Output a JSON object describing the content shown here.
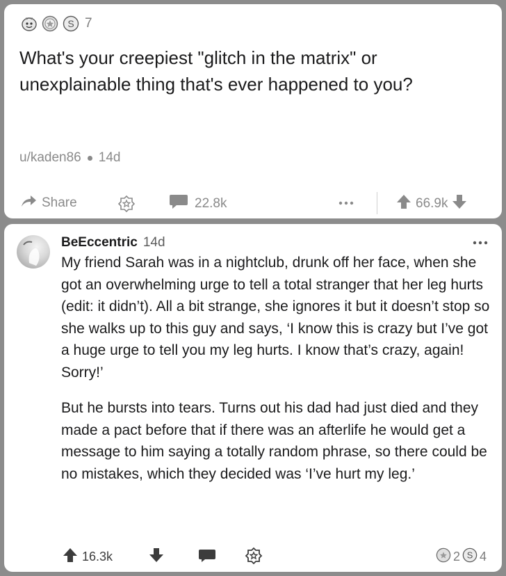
{
  "post": {
    "award_count": "7",
    "title": "What's your creepiest \"glitch in the matrix\" or unexplainable thing that's ever happened to you?",
    "author": "u/kaden86",
    "age": "14d",
    "actions": {
      "share_label": "Share",
      "comments_count": "22.8k",
      "vote_score": "66.9k"
    }
  },
  "comment": {
    "username": "BeEccentric",
    "age": "14d",
    "paragraphs": [
      "My friend Sarah was in a nightclub, drunk off her face, when she got an overwhelming urge to tell a total stranger that her leg hurts (edit: it didn’t). All a bit strange, she ignores it but it doesn’t stop so she walks up to this guy and says, ‘I know this is crazy but I’ve got a huge urge to tell you my leg hurts. I know that’s crazy, again! Sorry!’",
      "But he bursts into tears. Turns out his dad had just died and they made a pact before that if there was an afterlife he would get a message to him saying a totally random phrase, so there could be no mistakes, which they decided was ‘I’ve hurt my leg.’"
    ],
    "vote_score": "16.3k",
    "award_count_gold": "2",
    "award_count_silver": "4"
  },
  "icons": {
    "award_1": "wholesome-award-icon",
    "award_2": "gold-award-icon",
    "award_3": "silver-award-icon",
    "share": "share-arrow-icon",
    "award_button": "award-badge-icon",
    "comments": "speech-bubble-icon",
    "more": "more-dots-icon",
    "upvote": "arrow-up-icon",
    "downvote": "arrow-down-icon"
  },
  "colors": {
    "background": "#8c8c8c",
    "card": "#ffffff",
    "muted_text": "#8a8a8a",
    "text": "#1a1a1b"
  }
}
